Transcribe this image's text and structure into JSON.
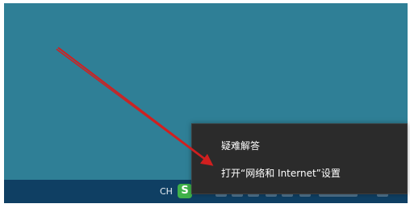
{
  "context_menu": {
    "items": [
      {
        "label": "疑难解答"
      },
      {
        "label": "打开“网络和 Internet”设置"
      }
    ]
  },
  "taskbar": {
    "language_indicator": "CH",
    "ime_icon_glyph": "S",
    "ime_icon_name": "sogou-ime-icon"
  },
  "colors": {
    "desktop": "#2f7f96",
    "taskbar": "#0f3f63",
    "menu_bg": "#2b2b2b",
    "annotation_arrow": "#d11f1f"
  },
  "annotation": {
    "type": "arrow",
    "points_to": "打开“网络和 Internet”设置"
  }
}
